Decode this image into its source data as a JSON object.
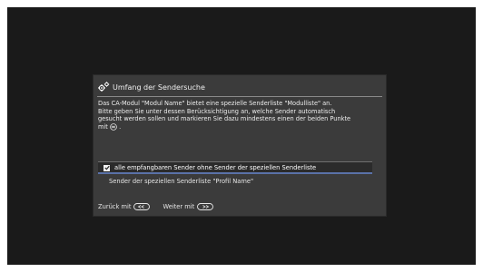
{
  "dialog": {
    "title": "Umfang der Sendersuche",
    "description_lines": [
      "Das CA-Modul \"Modul Name\" bietet eine spezielle Senderliste \"Modulliste\" an.",
      "Bitte geben Sie unter dessen Berücksichtigung an, welche Sender automatisch",
      "gesucht werden sollen und markieren Sie dazu mindestens einen der beiden Punkte",
      "mit",
      "."
    ],
    "options": [
      {
        "label": "alle empfangbaren Sender ohne Sender der speziellen Senderliste",
        "checked": true,
        "selected": true
      },
      {
        "label": "Sender der speziellen Senderliste \"Profil Name\"",
        "checked": false,
        "selected": false
      }
    ],
    "footer": {
      "back_label": "Zurück mit",
      "next_label": "Weiter mit"
    }
  },
  "colors": {
    "screen_bg": "#1a1a1a",
    "dialog_bg": "#3b3b3b",
    "selection_accent": "#5a72a8"
  },
  "icons": {
    "title_icon": "gears-icon",
    "inline_ok_icon": "ok-button-icon",
    "back_key_icon": "back-key-icon",
    "next_key_icon": "next-key-icon"
  }
}
